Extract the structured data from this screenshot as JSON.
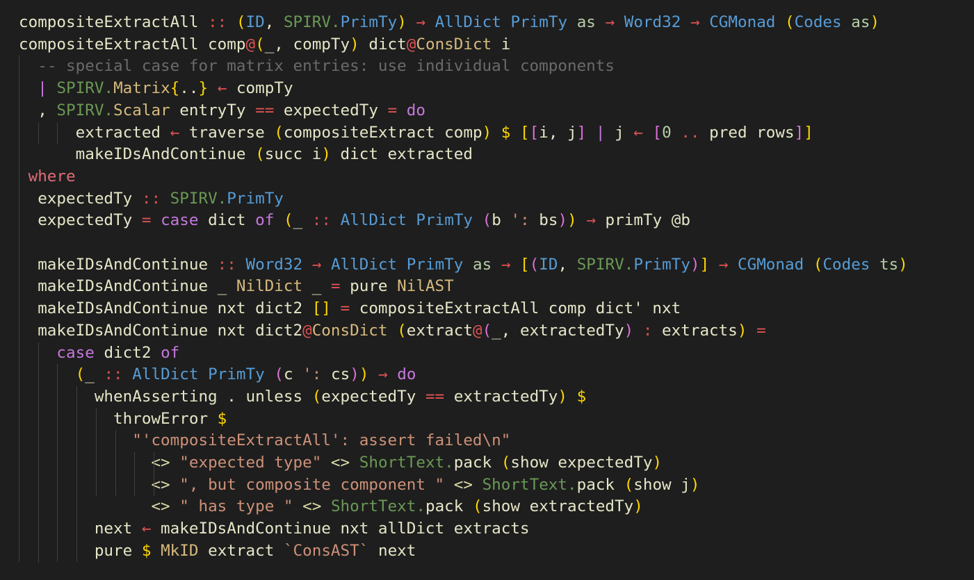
{
  "editor": {
    "lines": [
      [
        [
          "ident",
          "compositeExtractAll "
        ],
        [
          "op",
          "::"
        ],
        [
          "ident",
          " "
        ],
        [
          "p1",
          "("
        ],
        [
          "ty",
          "ID"
        ],
        [
          "ident",
          ", "
        ],
        [
          "mod",
          "SPIRV."
        ],
        [
          "ty",
          "PrimTy"
        ],
        [
          "p1",
          ")"
        ],
        [
          "ident",
          " "
        ],
        [
          "op",
          "→"
        ],
        [
          "ident",
          " "
        ],
        [
          "ty",
          "AllDict"
        ],
        [
          "ident",
          " "
        ],
        [
          "ty",
          "PrimTy"
        ],
        [
          "ident",
          " "
        ],
        [
          "tv",
          "as"
        ],
        [
          "ident",
          " "
        ],
        [
          "op",
          "→"
        ],
        [
          "ident",
          " "
        ],
        [
          "ty",
          "Word32"
        ],
        [
          "ident",
          " "
        ],
        [
          "op",
          "→"
        ],
        [
          "ident",
          " "
        ],
        [
          "ty",
          "CGMonad"
        ],
        [
          "ident",
          " "
        ],
        [
          "p1",
          "("
        ],
        [
          "ty",
          "Codes"
        ],
        [
          "ident",
          " "
        ],
        [
          "tv",
          "as"
        ],
        [
          "p1",
          ")"
        ]
      ],
      [
        [
          "ident",
          "compositeExtractAll comp"
        ],
        [
          "op",
          "@"
        ],
        [
          "p1",
          "("
        ],
        [
          "ident",
          "_, compTy"
        ],
        [
          "p1",
          ")"
        ],
        [
          "ident",
          " dict"
        ],
        [
          "op",
          "@"
        ],
        [
          "ctor",
          "ConsDict"
        ],
        [
          "ident",
          " i"
        ]
      ],
      [
        [
          "ident",
          "  "
        ],
        [
          "cm",
          "-- special case for matrix entries: use individual components"
        ]
      ],
      [
        [
          "ident",
          "  "
        ],
        [
          "k",
          "|"
        ],
        [
          "ident",
          " "
        ],
        [
          "mod",
          "SPIRV."
        ],
        [
          "ctor",
          "Matrix"
        ],
        [
          "p1",
          "{"
        ],
        [
          "ident",
          ".."
        ],
        [
          "p1",
          "}"
        ],
        [
          "ident",
          " "
        ],
        [
          "op",
          "←"
        ],
        [
          "ident",
          " compTy"
        ]
      ],
      [
        [
          "ident",
          "  , "
        ],
        [
          "mod",
          "SPIRV."
        ],
        [
          "ctor",
          "Scalar"
        ],
        [
          "ident",
          " entryTy "
        ],
        [
          "op",
          "=="
        ],
        [
          "ident",
          " expectedTy "
        ],
        [
          "op",
          "="
        ],
        [
          "ident",
          " "
        ],
        [
          "k",
          "do"
        ]
      ],
      [
        [
          "ident",
          "      extracted "
        ],
        [
          "op",
          "←"
        ],
        [
          "ident",
          " traverse "
        ],
        [
          "p1",
          "("
        ],
        [
          "ident",
          "compositeExtract comp"
        ],
        [
          "p1",
          ")"
        ],
        [
          "ident",
          " "
        ],
        [
          "p1",
          "$"
        ],
        [
          "ident",
          " "
        ],
        [
          "p1",
          "["
        ],
        [
          "p2",
          "["
        ],
        [
          "ident",
          "i, j"
        ],
        [
          "p2",
          "]"
        ],
        [
          "ident",
          " "
        ],
        [
          "k",
          "|"
        ],
        [
          "ident",
          " j "
        ],
        [
          "op",
          "←"
        ],
        [
          "ident",
          " "
        ],
        [
          "p2",
          "["
        ],
        [
          "num",
          "0"
        ],
        [
          "ident",
          " "
        ],
        [
          "op",
          ".."
        ],
        [
          "ident",
          " pred rows"
        ],
        [
          "p2",
          "]"
        ],
        [
          "p1",
          "]"
        ]
      ],
      [
        [
          "ident",
          "      makeIDsAndContinue "
        ],
        [
          "p1",
          "("
        ],
        [
          "ident",
          "succ i"
        ],
        [
          "p1",
          ")"
        ],
        [
          "ident",
          " dict extracted"
        ]
      ],
      [
        [
          "w",
          " where"
        ]
      ],
      [
        [
          "ident",
          "  expectedTy "
        ],
        [
          "op",
          "::"
        ],
        [
          "ident",
          " "
        ],
        [
          "mod",
          "SPIRV."
        ],
        [
          "ty",
          "PrimTy"
        ]
      ],
      [
        [
          "ident",
          "  expectedTy "
        ],
        [
          "op",
          "="
        ],
        [
          "ident",
          " "
        ],
        [
          "k",
          "case"
        ],
        [
          "ident",
          " dict "
        ],
        [
          "k",
          "of"
        ],
        [
          "ident",
          " "
        ],
        [
          "p1",
          "("
        ],
        [
          "ident",
          "_ "
        ],
        [
          "op",
          "::"
        ],
        [
          "ident",
          " "
        ],
        [
          "ty",
          "AllDict"
        ],
        [
          "ident",
          " "
        ],
        [
          "ty",
          "PrimTy"
        ],
        [
          "ident",
          " "
        ],
        [
          "p2",
          "("
        ],
        [
          "ident",
          "b "
        ],
        [
          "str",
          "':"
        ],
        [
          "ident",
          " bs"
        ],
        [
          "p2",
          ")"
        ],
        [
          "p1",
          ")"
        ],
        [
          "ident",
          " "
        ],
        [
          "op",
          "→"
        ],
        [
          "ident",
          " primTy @b"
        ]
      ],
      [
        [
          "ident",
          ""
        ]
      ],
      [
        [
          "ident",
          "  makeIDsAndContinue "
        ],
        [
          "op",
          "::"
        ],
        [
          "ident",
          " "
        ],
        [
          "ty",
          "Word32"
        ],
        [
          "ident",
          " "
        ],
        [
          "op",
          "→"
        ],
        [
          "ident",
          " "
        ],
        [
          "ty",
          "AllDict"
        ],
        [
          "ident",
          " "
        ],
        [
          "ty",
          "PrimTy"
        ],
        [
          "ident",
          " "
        ],
        [
          "tv",
          "as"
        ],
        [
          "ident",
          " "
        ],
        [
          "op",
          "→"
        ],
        [
          "ident",
          " "
        ],
        [
          "p1",
          "["
        ],
        [
          "p2",
          "("
        ],
        [
          "ty",
          "ID"
        ],
        [
          "ident",
          ", "
        ],
        [
          "mod",
          "SPIRV."
        ],
        [
          "ty",
          "PrimTy"
        ],
        [
          "p2",
          ")"
        ],
        [
          "p1",
          "]"
        ],
        [
          "ident",
          " "
        ],
        [
          "op",
          "→"
        ],
        [
          "ident",
          " "
        ],
        [
          "ty",
          "CGMonad"
        ],
        [
          "ident",
          " "
        ],
        [
          "p1",
          "("
        ],
        [
          "ty",
          "Codes"
        ],
        [
          "ident",
          " "
        ],
        [
          "tv",
          "ts"
        ],
        [
          "p1",
          ")"
        ]
      ],
      [
        [
          "ident",
          "  makeIDsAndContinue _ "
        ],
        [
          "ctor",
          "NilDict"
        ],
        [
          "ident",
          " _ "
        ],
        [
          "op",
          "="
        ],
        [
          "ident",
          " pure "
        ],
        [
          "ctor",
          "NilAST"
        ]
      ],
      [
        [
          "ident",
          "  makeIDsAndContinue nxt dict2 "
        ],
        [
          "p1",
          "[]"
        ],
        [
          "ident",
          " "
        ],
        [
          "op",
          "="
        ],
        [
          "ident",
          " compositeExtractAll comp dict' nxt"
        ]
      ],
      [
        [
          "ident",
          "  makeIDsAndContinue nxt dict2"
        ],
        [
          "op",
          "@"
        ],
        [
          "ctor",
          "ConsDict"
        ],
        [
          "ident",
          " "
        ],
        [
          "p1",
          "("
        ],
        [
          "ident",
          "extract"
        ],
        [
          "op",
          "@"
        ],
        [
          "p2",
          "("
        ],
        [
          "ident",
          "_, extractedTy"
        ],
        [
          "p2",
          ")"
        ],
        [
          "ident",
          " "
        ],
        [
          "op",
          ":"
        ],
        [
          "ident",
          " extracts"
        ],
        [
          "p1",
          ")"
        ],
        [
          "ident",
          " "
        ],
        [
          "op",
          "="
        ]
      ],
      [
        [
          "ident",
          "    "
        ],
        [
          "k",
          "case"
        ],
        [
          "ident",
          " dict2 "
        ],
        [
          "k",
          "of"
        ]
      ],
      [
        [
          "ident",
          "      "
        ],
        [
          "p1",
          "("
        ],
        [
          "ident",
          "_ "
        ],
        [
          "op",
          "::"
        ],
        [
          "ident",
          " "
        ],
        [
          "ty",
          "AllDict"
        ],
        [
          "ident",
          " "
        ],
        [
          "ty",
          "PrimTy"
        ],
        [
          "ident",
          " "
        ],
        [
          "p2",
          "("
        ],
        [
          "ident",
          "c "
        ],
        [
          "str",
          "':"
        ],
        [
          "ident",
          " cs"
        ],
        [
          "p2",
          ")"
        ],
        [
          "p1",
          ")"
        ],
        [
          "ident",
          " "
        ],
        [
          "op",
          "→"
        ],
        [
          "ident",
          " "
        ],
        [
          "k",
          "do"
        ]
      ],
      [
        [
          "ident",
          "        whenAsserting . unless "
        ],
        [
          "p1",
          "("
        ],
        [
          "ident",
          "expectedTy "
        ],
        [
          "op",
          "=="
        ],
        [
          "ident",
          " extractedTy"
        ],
        [
          "p1",
          ")"
        ],
        [
          "ident",
          " "
        ],
        [
          "p1",
          "$"
        ]
      ],
      [
        [
          "ident",
          "          throwError "
        ],
        [
          "p1",
          "$"
        ]
      ],
      [
        [
          "ident",
          "            "
        ],
        [
          "str",
          "\"'compositeExtractAll': assert failed\\n\""
        ]
      ],
      [
        [
          "ident",
          "              "
        ],
        [
          "con",
          "<>"
        ],
        [
          "ident",
          " "
        ],
        [
          "str",
          "\"expected type\""
        ],
        [
          "ident",
          " "
        ],
        [
          "con",
          "<>"
        ],
        [
          "ident",
          " "
        ],
        [
          "mod",
          "ShortText."
        ],
        [
          "ident",
          "pack "
        ],
        [
          "p1",
          "("
        ],
        [
          "ident",
          "show expectedTy"
        ],
        [
          "p1",
          ")"
        ]
      ],
      [
        [
          "ident",
          "              "
        ],
        [
          "con",
          "<>"
        ],
        [
          "ident",
          " "
        ],
        [
          "str",
          "\", but composite component \""
        ],
        [
          "ident",
          " "
        ],
        [
          "con",
          "<>"
        ],
        [
          "ident",
          " "
        ],
        [
          "mod",
          "ShortText."
        ],
        [
          "ident",
          "pack "
        ],
        [
          "p1",
          "("
        ],
        [
          "ident",
          "show j"
        ],
        [
          "p1",
          ")"
        ]
      ],
      [
        [
          "ident",
          "              "
        ],
        [
          "con",
          "<>"
        ],
        [
          "ident",
          " "
        ],
        [
          "str",
          "\" has type \""
        ],
        [
          "ident",
          " "
        ],
        [
          "con",
          "<>"
        ],
        [
          "ident",
          " "
        ],
        [
          "mod",
          "ShortText."
        ],
        [
          "ident",
          "pack "
        ],
        [
          "p1",
          "("
        ],
        [
          "ident",
          "show extractedTy"
        ],
        [
          "p1",
          ")"
        ]
      ],
      [
        [
          "ident",
          "        next "
        ],
        [
          "op",
          "←"
        ],
        [
          "ident",
          " makeIDsAndContinue nxt allDict extracts"
        ]
      ],
      [
        [
          "ident",
          "        pure "
        ],
        [
          "p1",
          "$"
        ],
        [
          "ident",
          " "
        ],
        [
          "ctor",
          "MkID"
        ],
        [
          "ident",
          " extract "
        ],
        [
          "str",
          "`ConsAST`"
        ],
        [
          "ident",
          " next"
        ]
      ]
    ]
  }
}
